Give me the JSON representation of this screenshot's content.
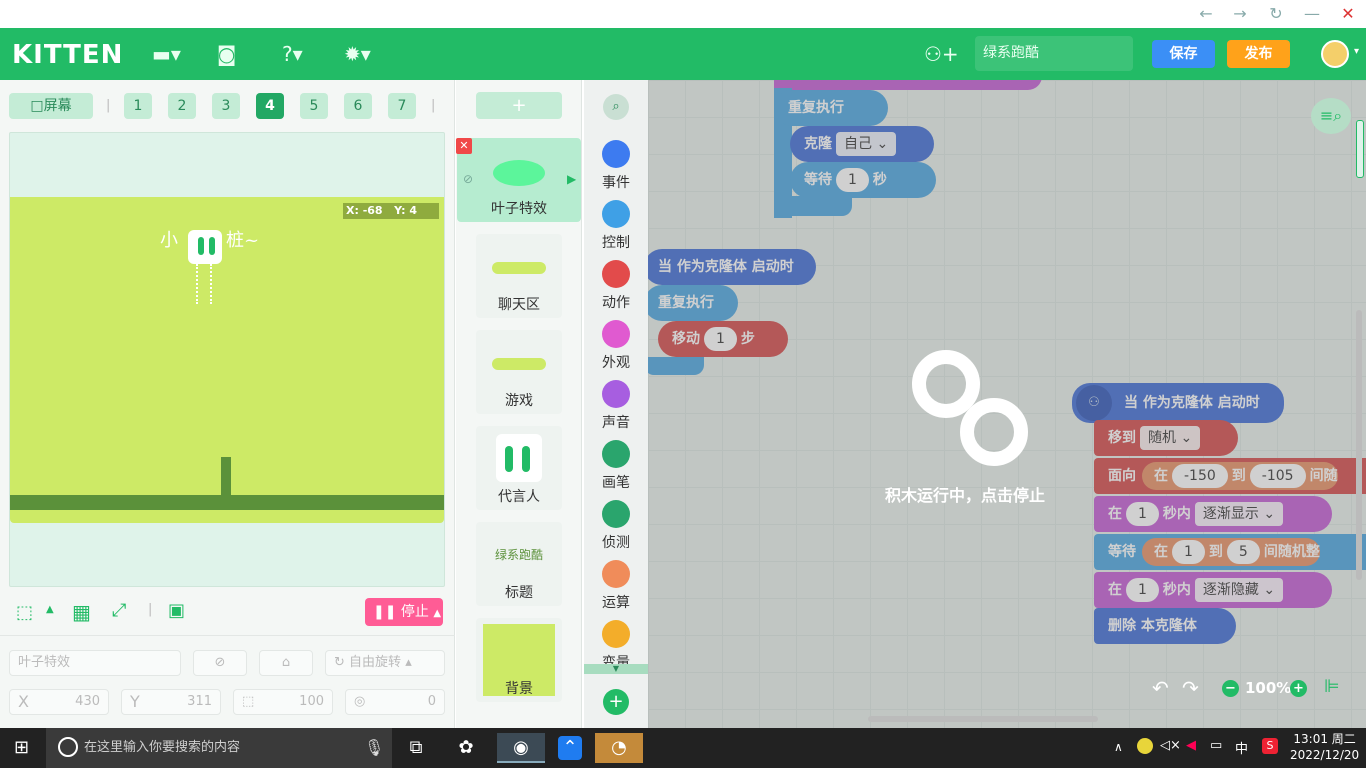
{
  "window": {
    "back_icon": "arrow-left-icon",
    "forward_icon": "arrow-right-icon",
    "refresh_icon": "refresh-icon",
    "minimize_icon": "minimize-icon",
    "close_icon": "close-icon"
  },
  "header": {
    "logo": "KITTEN",
    "project_name": "绿系跑酷",
    "save_label": "保存",
    "publish_label": "发布",
    "brand_color": "#22bb66"
  },
  "stage_toolbar": {
    "screen_label": "□屏幕",
    "screens": [
      "1",
      "2",
      "3",
      "4",
      "5",
      "6",
      "7"
    ],
    "active_screen": "4"
  },
  "stage": {
    "coord_x": "X: -68",
    "coord_y": "Y: 4",
    "text_left": "小",
    "text_right": "桩~",
    "stop_label": "停止"
  },
  "properties": {
    "name_placeholder": "叶子特效",
    "rotation_label": "自由旋转",
    "x_label": "X",
    "x_value": "430",
    "y_label": "Y",
    "y_value": "311",
    "size_value": "100",
    "direction_value": "0"
  },
  "sprites": {
    "add_label": "+",
    "items": [
      {
        "name": "叶子特效"
      },
      {
        "name": "聊天区"
      },
      {
        "name": "游戏"
      },
      {
        "name": "代言人"
      },
      {
        "name": "标题",
        "thumb_text": "绿系跑酷"
      },
      {
        "name": "背景"
      }
    ]
  },
  "categories": [
    {
      "label": "事件",
      "color": "#3d7bf0"
    },
    {
      "label": "控制",
      "color": "#3fa0e6"
    },
    {
      "label": "动作",
      "color": "#e24b4b"
    },
    {
      "label": "外观",
      "color": "#e05ad0"
    },
    {
      "label": "声音",
      "color": "#a75ee0"
    },
    {
      "label": "画笔",
      "color": "#2aa56d"
    },
    {
      "label": "侦测",
      "color": "#2aa56d"
    },
    {
      "label": "运算",
      "color": "#f08c5a"
    },
    {
      "label": "变量",
      "color": "#f3ad2a"
    }
  ],
  "blocks": {
    "repeat1": "重复执行",
    "clone": "克隆",
    "clone_target": "自己",
    "wait": "等待",
    "wait_value": "1",
    "wait_unit": "秒",
    "hat1": "当 作为克隆体 启动时",
    "repeat2": "重复执行",
    "move": "移动",
    "move_value": "1",
    "move_unit": "步",
    "hat2": "当 作为克隆体 启动时",
    "goto": "移到",
    "goto_target": "随机",
    "face": "面向",
    "face_in": "在",
    "face_from": "-150",
    "face_to_word": "到",
    "face_to": "-105",
    "face_tail": "间随",
    "fadein_in": "在",
    "fadein_value": "1",
    "fadein_unit": "秒内",
    "fadein_action": "逐渐显示",
    "wait2": "等待",
    "wait2_in": "在",
    "wait2_from": "1",
    "wait2_to_word": "到",
    "wait2_to": "5",
    "wait2_tail": "间随机整",
    "fadeout_in": "在",
    "fadeout_value": "1",
    "fadeout_unit": "秒内",
    "fadeout_action": "逐渐隐藏",
    "delete_clone": "删除 本克隆体"
  },
  "workspace": {
    "busy_text": "积木运行中，点击停止",
    "zoom": "100%"
  },
  "taskbar": {
    "search_placeholder": "在这里输入你要搜索的内容",
    "ime": "中",
    "time": "13:01 周二",
    "date": "2022/12/20"
  }
}
